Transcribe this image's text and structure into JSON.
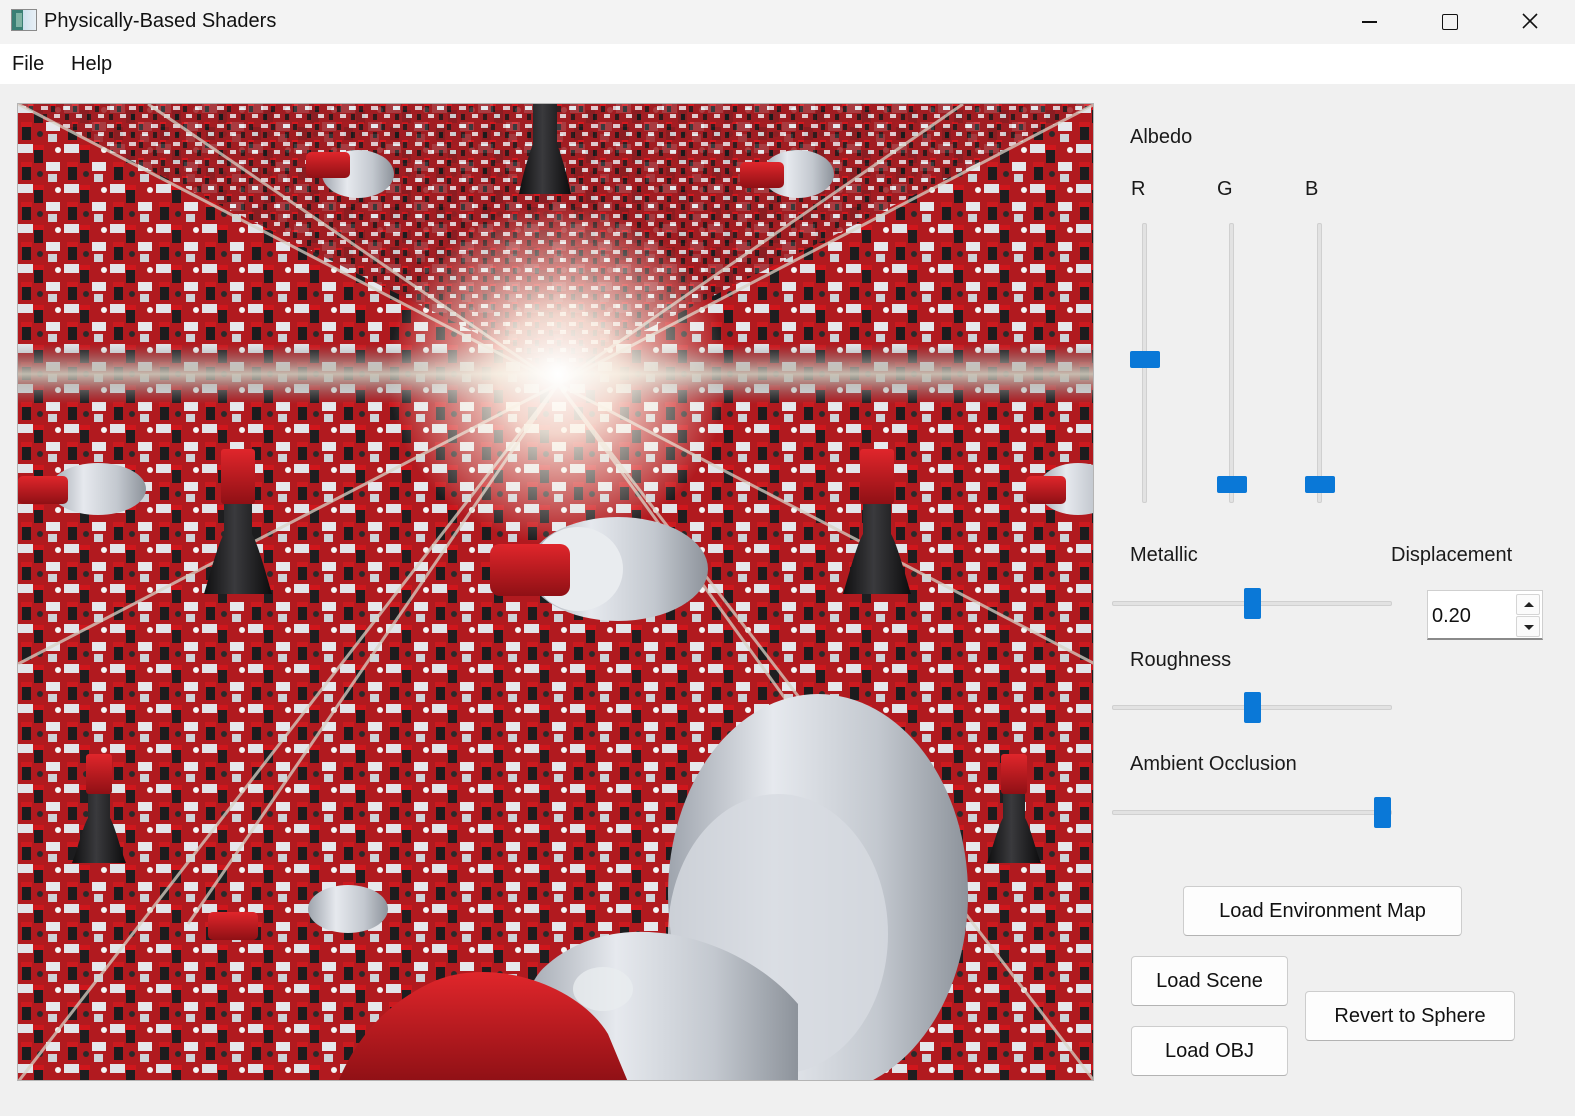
{
  "window": {
    "title": "Physically-Based Shaders",
    "icon": "app-icon",
    "controls": [
      "minimize-icon",
      "maximize-icon",
      "close-icon"
    ]
  },
  "menu": {
    "items": [
      {
        "label": "File"
      },
      {
        "label": "Help"
      }
    ]
  },
  "viewport": {
    "content": "render-viewport",
    "colors": {
      "red": "#c8161c",
      "white": "#dfe2e6",
      "black": "#1c1c1e",
      "sky": "#f4efe6"
    }
  },
  "panel": {
    "albedo": {
      "label": "Albedo",
      "channels": [
        {
          "label": "R",
          "value": 0.5
        },
        {
          "label": "G",
          "value": 0.0
        },
        {
          "label": "B",
          "value": 0.0
        }
      ]
    },
    "metallic": {
      "label": "Metallic",
      "value": 0.5
    },
    "displacement": {
      "label": "Displacement",
      "value": "0.20"
    },
    "roughness": {
      "label": "Roughness",
      "value": 0.5
    },
    "ambient_occlusion": {
      "label": "Ambient Occlusion",
      "value": 1.0
    },
    "buttons": {
      "load_env_map": "Load Environment Map",
      "load_scene": "Load Scene",
      "load_obj": "Load OBJ",
      "revert_sphere": "Revert to Sphere"
    },
    "accent": "#0a78d7"
  }
}
